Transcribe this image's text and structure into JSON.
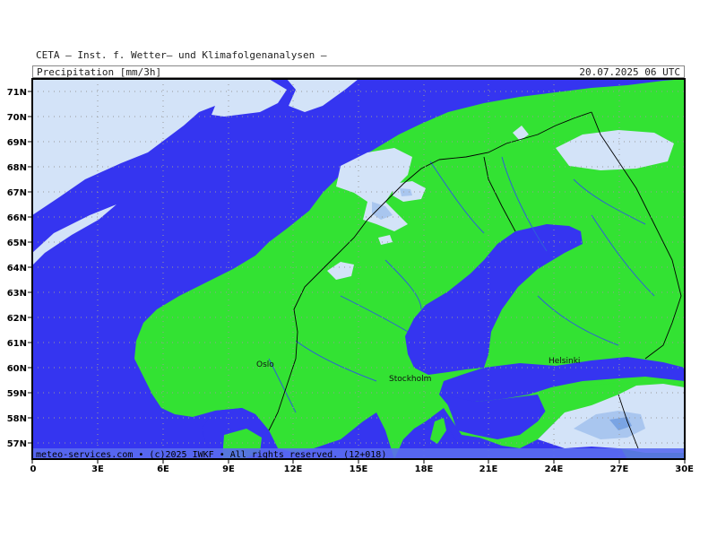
{
  "header": {
    "institute": "CETA — Inst. f. Wetter— und Klimafolgenanalysen —",
    "title_left": "Precipitation [mm/3h]",
    "title_right": "20.07.2025 06 UTC"
  },
  "axes": {
    "lat_labels": [
      "71N",
      "70N",
      "69N",
      "68N",
      "67N",
      "66N",
      "65N",
      "64N",
      "63N",
      "62N",
      "61N",
      "60N",
      "59N",
      "58N",
      "57N"
    ],
    "lon_labels": [
      "0",
      "3E",
      "6E",
      "9E",
      "12E",
      "15E",
      "18E",
      "21E",
      "24E",
      "27E",
      "30E"
    ]
  },
  "cities": {
    "oslo": "Oslo",
    "stockholm": "Stockholm",
    "helsinki": "Helsinki"
  },
  "credit": "meteo-services.com • (c)2025 IWKF • All rights reserved. (12+018)",
  "colors": {
    "sea": "#3535f0",
    "land": "#33e233",
    "precip_light": "#d3e3f8",
    "precip_medium": "#a9c6ef",
    "precip_heavy": "#7aa4e3",
    "border": "#000000",
    "river": "#2e5fd8"
  }
}
